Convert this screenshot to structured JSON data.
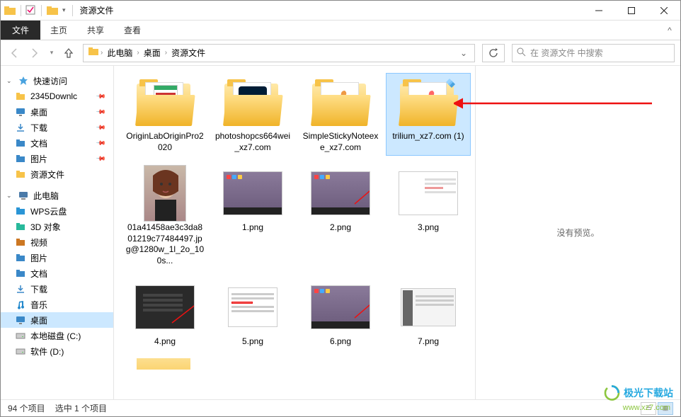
{
  "window": {
    "title": "资源文件"
  },
  "ribbon": {
    "file": "文件",
    "tabs": [
      "主页",
      "共享",
      "查看"
    ]
  },
  "breadcrumb": {
    "items": [
      "此电脑",
      "桌面",
      "资源文件"
    ]
  },
  "search": {
    "placeholder": "在 资源文件 中搜索"
  },
  "sidebar": {
    "quick": {
      "label": "快速访问",
      "items": [
        {
          "label": "2345Downlc",
          "icon": "folder",
          "pin": true
        },
        {
          "label": "桌面",
          "icon": "desktop",
          "pin": true
        },
        {
          "label": "下载",
          "icon": "download",
          "pin": true
        },
        {
          "label": "文档",
          "icon": "document",
          "pin": true
        },
        {
          "label": "图片",
          "icon": "pictures",
          "pin": true
        },
        {
          "label": "资源文件",
          "icon": "folder",
          "pin": false
        }
      ]
    },
    "thispc": {
      "label": "此电脑",
      "items": [
        {
          "label": "WPS云盘",
          "icon": "wps"
        },
        {
          "label": "3D 对象",
          "icon": "3d"
        },
        {
          "label": "视频",
          "icon": "video"
        },
        {
          "label": "图片",
          "icon": "pictures"
        },
        {
          "label": "文档",
          "icon": "document"
        },
        {
          "label": "下载",
          "icon": "download"
        },
        {
          "label": "音乐",
          "icon": "music"
        },
        {
          "label": "桌面",
          "icon": "desktop",
          "selected": true
        },
        {
          "label": "本地磁盘 (C:)",
          "icon": "disk"
        },
        {
          "label": "软件 (D:)",
          "icon": "disk"
        }
      ]
    }
  },
  "files": [
    {
      "name": "OriginLabOriginPro2020",
      "type": "folder",
      "overlay": "origin"
    },
    {
      "name": "photoshopcs664wei_xz7.com",
      "type": "folder",
      "overlay": "ps"
    },
    {
      "name": "SimpleStickyNoteexe_xz7.com",
      "type": "folder",
      "overlay": "pinwheel"
    },
    {
      "name": "trilium_xz7.com (1)",
      "type": "folder",
      "overlay": "pinwheel-light",
      "selected": true
    },
    {
      "name": "01a41458ae3c3da801219c77484497.jpg@1280w_1l_2o_100s...",
      "type": "image",
      "thumb": "portrait"
    },
    {
      "name": "1.png",
      "type": "image",
      "thumb": "desk1"
    },
    {
      "name": "2.png",
      "type": "image",
      "thumb": "desk2"
    },
    {
      "name": "3.png",
      "type": "image",
      "thumb": "white"
    },
    {
      "name": "4.png",
      "type": "image",
      "thumb": "menu"
    },
    {
      "name": "5.png",
      "type": "image",
      "thumb": "list"
    },
    {
      "name": "6.png",
      "type": "image",
      "thumb": "desk3"
    },
    {
      "name": "7.png",
      "type": "image",
      "thumb": "panel"
    }
  ],
  "preview": {
    "text": "没有预览。"
  },
  "status": {
    "count": "94 个项目",
    "selected": "选中 1 个项目"
  },
  "watermark": {
    "text": "极光下载站",
    "url": "www.xz7.com"
  }
}
